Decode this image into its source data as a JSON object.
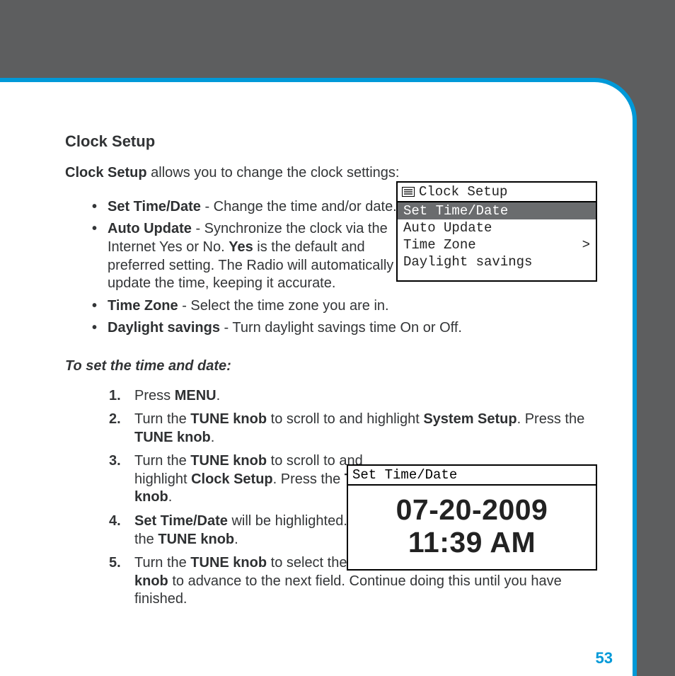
{
  "section_title": "Clock Setup",
  "intro_strong": "Clock Setup",
  "intro_rest": " allows you to change the clock settings:",
  "bullets": {
    "b1_strong": "Set Time/Date",
    "b1_rest": " - Change the time and/or date.",
    "b2_strong": "Auto Update",
    "b2_mid": " - Synchronize the clock via the Internet Yes or No. ",
    "b2_yes": "Yes",
    "b2_end": " is the default and preferred setting. The Radio will automatically update the time, keeping it accurate.",
    "b3_strong": "Time Zone",
    "b3_rest": " - Select the time zone you are in.",
    "b4_strong": "Daylight savings",
    "b4_rest": " - Turn daylight savings time On or Off."
  },
  "subhead": "To set the time and date:",
  "steps": {
    "s1_a": "Press ",
    "s1_b": "MENU",
    "s1_c": ".",
    "s2_a": "Turn the ",
    "s2_b": "TUNE knob",
    "s2_c": " to scroll to and highlight ",
    "s2_d": "System Setup",
    "s2_e": ". Press the ",
    "s2_f": "TUNE knob",
    "s2_g": ".",
    "s3_a": "Turn the ",
    "s3_b": "TUNE knob",
    "s3_c": " to scroll to and highlight ",
    "s3_d": "Clock Setup",
    "s3_e": ". Press the ",
    "s3_f": "TUNE knob",
    "s3_g": ".",
    "s4_a": "Set Time/Date",
    "s4_b": " will be highlighted. Press the ",
    "s4_c": "TUNE knob",
    "s4_d": ".",
    "s5_a": "Turn the ",
    "s5_b": "TUNE knob",
    "s5_c": " to select the desired hour, and press the ",
    "s5_d": "TUNE knob",
    "s5_e": " to advance to the next field. Continue doing this until you have finished."
  },
  "menu": {
    "title": "Clock Setup",
    "items": [
      {
        "label": "Set Time/Date",
        "selected": true,
        "arrow": ""
      },
      {
        "label": "Auto Update",
        "selected": false,
        "arrow": ""
      },
      {
        "label": "Time Zone",
        "selected": false,
        "arrow": ">"
      },
      {
        "label": "Daylight savings",
        "selected": false,
        "arrow": ""
      }
    ]
  },
  "timebox": {
    "title": "Set Time/Date",
    "date": "07-20-2009",
    "time": "11:39 AM"
  },
  "page_number": "53"
}
